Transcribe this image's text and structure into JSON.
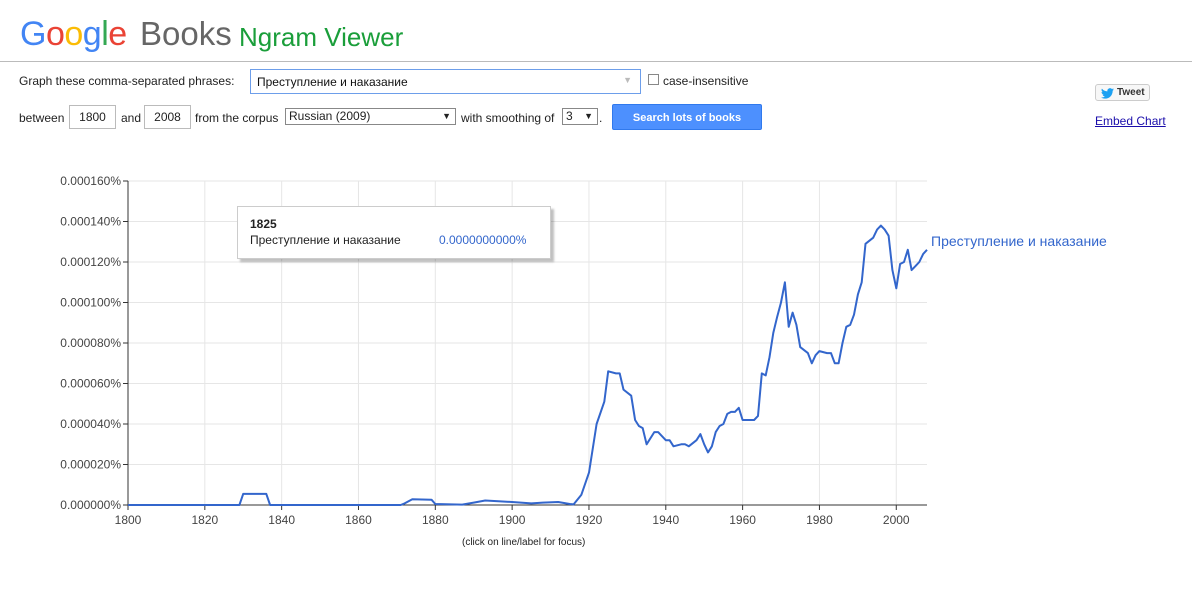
{
  "header": {
    "logo_letters": [
      "G",
      "o",
      "o",
      "g",
      "l",
      "e"
    ],
    "books": "Books",
    "ngram_viewer": "Ngram Viewer"
  },
  "form": {
    "phrases_label": "Graph these comma-separated phrases:",
    "phrase_value": "Преступление и наказание",
    "case_insensitive_label": "case-insensitive",
    "between_label": "between",
    "start_year": "1800",
    "and_label": "and",
    "end_year": "2008",
    "corpus_label": "from the corpus",
    "corpus_value": "Russian (2009)",
    "smoothing_label": "with smoothing of",
    "smoothing_value": "3",
    "period": ".",
    "search_button": "Search lots of books"
  },
  "sidebar": {
    "tweet_label": "Tweet",
    "embed_label": "Embed Chart"
  },
  "tooltip": {
    "year": "1825",
    "phrase": "Преступление и наказание",
    "value": "0.0000000000%"
  },
  "hint": "(click on line/label for focus)",
  "colors": {
    "series": "#3366cc",
    "button": "#4d90fe"
  },
  "chart_data": {
    "type": "line",
    "ylim": [
      0,
      0.00016
    ],
    "xlim": [
      1800,
      2008
    ],
    "y_ticks": [
      "0.000000%",
      "0.000020%",
      "0.000040%",
      "0.000060%",
      "0.000080%",
      "0.000100%",
      "0.000120%",
      "0.000140%",
      "0.000160%"
    ],
    "y_tick_values": [
      0,
      2e-05,
      4e-05,
      6e-05,
      8e-05,
      0.0001,
      0.00012,
      0.00014,
      0.00016
    ],
    "x_ticks": [
      "1800",
      "1820",
      "1840",
      "1860",
      "1880",
      "1900",
      "1920",
      "1940",
      "1960",
      "1980",
      "2000"
    ],
    "x_tick_values": [
      1800,
      1820,
      1840,
      1860,
      1880,
      1900,
      1920,
      1940,
      1960,
      1980,
      2000
    ],
    "series": [
      {
        "name": "Преступление и наказание",
        "points": [
          [
            1800,
            0
          ],
          [
            1828,
            0
          ],
          [
            1829,
            0
          ],
          [
            1830,
            5.5e-06
          ],
          [
            1836,
            5.5e-06
          ],
          [
            1837,
            0
          ],
          [
            1871,
            0
          ],
          [
            1872,
            8e-07
          ],
          [
            1874,
            2.8e-06
          ],
          [
            1879,
            2.6e-06
          ],
          [
            1880,
            5e-07
          ],
          [
            1887,
            2e-07
          ],
          [
            1890,
            1.2e-06
          ],
          [
            1893,
            2.2e-06
          ],
          [
            1897,
            1.8e-06
          ],
          [
            1900,
            1.5e-06
          ],
          [
            1905,
            8e-07
          ],
          [
            1908,
            1.2e-06
          ],
          [
            1912,
            1.5e-06
          ],
          [
            1915,
            5e-07
          ],
          [
            1916,
            3e-07
          ],
          [
            1918,
            5e-06
          ],
          [
            1920,
            1.6e-05
          ],
          [
            1922,
            4e-05
          ],
          [
            1924,
            5.1e-05
          ],
          [
            1925,
            6.6e-05
          ],
          [
            1927,
            6.5e-05
          ],
          [
            1928,
            6.5e-05
          ],
          [
            1929,
            5.7e-05
          ],
          [
            1931,
            5.4e-05
          ],
          [
            1932,
            4.2e-05
          ],
          [
            1933,
            3.9e-05
          ],
          [
            1934,
            3.8e-05
          ],
          [
            1935,
            3e-05
          ],
          [
            1937,
            3.6e-05
          ],
          [
            1938,
            3.6e-05
          ],
          [
            1940,
            3.2e-05
          ],
          [
            1941,
            3.2e-05
          ],
          [
            1942,
            2.9e-05
          ],
          [
            1944,
            3e-05
          ],
          [
            1945,
            3e-05
          ],
          [
            1946,
            2.9e-05
          ],
          [
            1948,
            3.2e-05
          ],
          [
            1949,
            3.5e-05
          ],
          [
            1950,
            3e-05
          ],
          [
            1951,
            2.6e-05
          ],
          [
            1952,
            2.9e-05
          ],
          [
            1953,
            3.6e-05
          ],
          [
            1954,
            3.9e-05
          ],
          [
            1955,
            4e-05
          ],
          [
            1956,
            4.5e-05
          ],
          [
            1957,
            4.6e-05
          ],
          [
            1958,
            4.6e-05
          ],
          [
            1959,
            4.8e-05
          ],
          [
            1960,
            4.2e-05
          ],
          [
            1962,
            4.2e-05
          ],
          [
            1963,
            4.2e-05
          ],
          [
            1964,
            4.4e-05
          ],
          [
            1965,
            6.5e-05
          ],
          [
            1966,
            6.4e-05
          ],
          [
            1967,
            7.3e-05
          ],
          [
            1968,
            8.5e-05
          ],
          [
            1969,
            9.3e-05
          ],
          [
            1970,
            0.0001
          ],
          [
            1971,
            0.00011
          ],
          [
            1972,
            8.8e-05
          ],
          [
            1973,
            9.5e-05
          ],
          [
            1974,
            8.9e-05
          ],
          [
            1975,
            7.8e-05
          ],
          [
            1977,
            7.5e-05
          ],
          [
            1978,
            7e-05
          ],
          [
            1979,
            7.4e-05
          ],
          [
            1980,
            7.6e-05
          ],
          [
            1982,
            7.5e-05
          ],
          [
            1983,
            7.5e-05
          ],
          [
            1984,
            7e-05
          ],
          [
            1985,
            7e-05
          ],
          [
            1986,
            8e-05
          ],
          [
            1987,
            8.8e-05
          ],
          [
            1988,
            8.9e-05
          ],
          [
            1989,
            9.4e-05
          ],
          [
            1990,
            0.000104
          ],
          [
            1991,
            0.00011
          ],
          [
            1992,
            0.000129
          ],
          [
            1994,
            0.000132
          ],
          [
            1995,
            0.000136
          ],
          [
            1996,
            0.000138
          ],
          [
            1997,
            0.000136
          ],
          [
            1998,
            0.000133
          ],
          [
            1999,
            0.000116
          ],
          [
            2000,
            0.000107
          ],
          [
            2001,
            0.000119
          ],
          [
            2002,
            0.00012
          ],
          [
            2003,
            0.000126
          ],
          [
            2004,
            0.000116
          ],
          [
            2005,
            0.000118
          ],
          [
            2006,
            0.00012
          ],
          [
            2007,
            0.000124
          ],
          [
            2008,
            0.000126
          ]
        ]
      }
    ]
  }
}
